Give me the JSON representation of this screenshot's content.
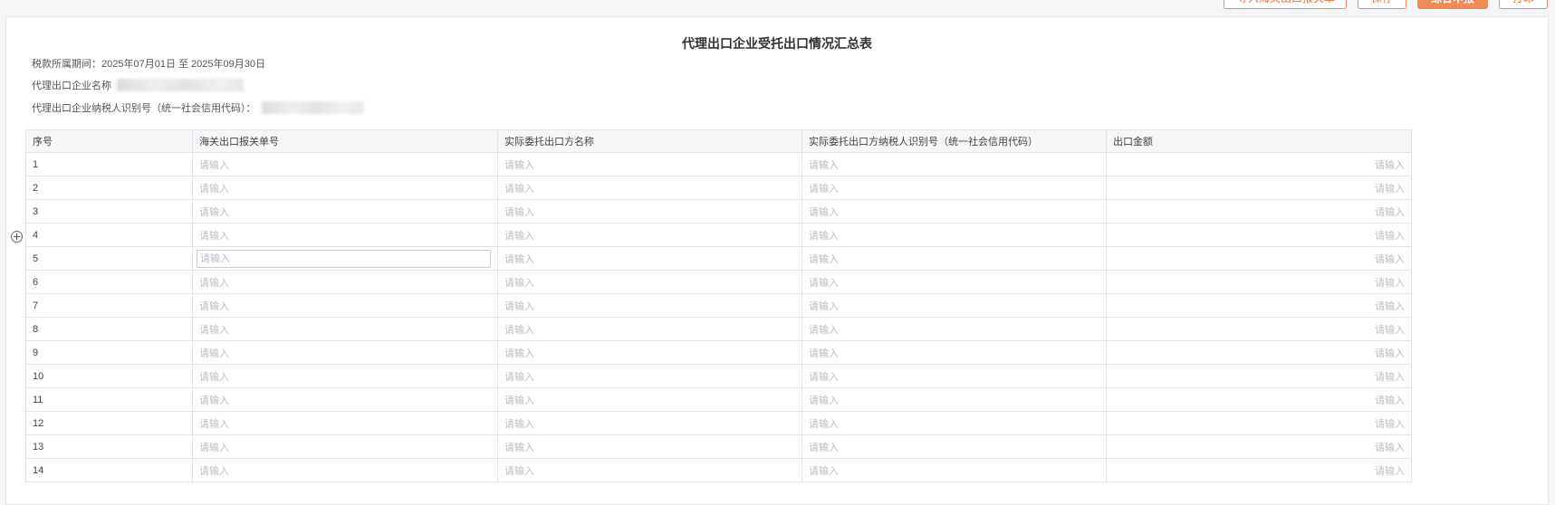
{
  "toolbar": {
    "import_label": "导入海关出口报关单",
    "save_label": "保存",
    "submit_label": "综合申报",
    "print_label": "打印"
  },
  "form": {
    "title": "代理出口企业受托出口情况汇总表",
    "period_label": "税款所属期间：",
    "period_value": "2025年07月01日 至 2025年09月30日",
    "company_name_label": "代理出口企业名称",
    "taxpayer_id_label": "代理出口企业纳税人识别号（统一社会信用代码）："
  },
  "table": {
    "headers": [
      "序号",
      "海关出口报关单号",
      "实际委托出口方名称",
      "实际委托出口方纳税人识别号（统一社会信用代码）",
      "出口金额"
    ],
    "placeholder": "请输入",
    "rows": [
      "1",
      "2",
      "3",
      "4",
      "5",
      "6",
      "7",
      "8",
      "9",
      "10",
      "11",
      "12",
      "13",
      "14"
    ]
  },
  "icons": {
    "add_row": "add-circle-icon"
  },
  "colors": {
    "accent": "#f08a56",
    "border": "#e1e3e8",
    "placeholder": "#b9bcc2"
  }
}
